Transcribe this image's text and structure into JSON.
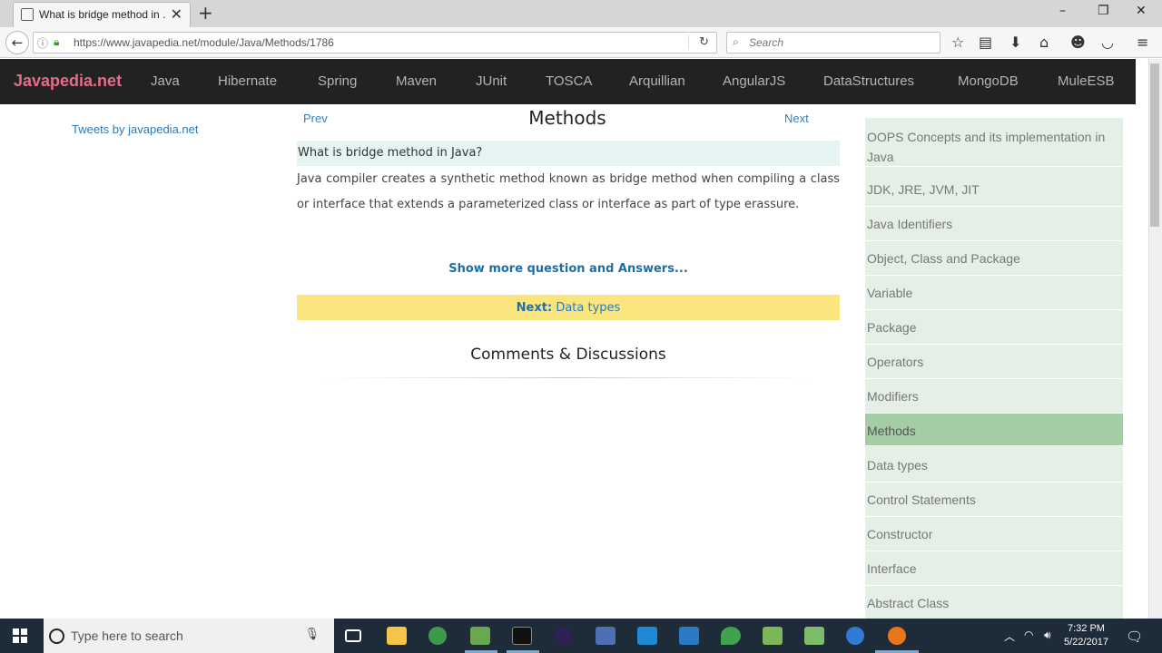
{
  "browser": {
    "tab_title": "What is bridge method in ...",
    "url": "https://www.javapedia.net/module/Java/Methods/1786",
    "search_placeholder": "Search"
  },
  "site": {
    "brand": "Javapedia.net",
    "nav": [
      "Java",
      "Hibernate",
      "Spring",
      "Maven",
      "JUnit",
      "TOSCA",
      "Arquillian",
      "AngularJS",
      "DataStructures",
      "MongoDB",
      "MuleESB"
    ]
  },
  "left": {
    "tweets_link": "Tweets by javapedia.net"
  },
  "main": {
    "prev": "Prev",
    "next": "Next",
    "title": "Methods",
    "question": "What is bridge method in Java?",
    "answer": "Java compiler creates a synthetic method known as bridge method when compiling a class or interface that extends a parameterized class or interface as part of type erassure.",
    "show_more": "Show more question and Answers...",
    "next_bar_label": "Next:",
    "next_bar_link": "Data types",
    "comments_heading": "Comments & Discussions"
  },
  "sidebar": {
    "items": [
      "OOPS Concepts and its implementation in Java",
      "JDK, JRE, JVM, JIT",
      "Java Identifiers",
      "Object, Class and Package",
      "Variable",
      "Package",
      "Operators",
      "Modifiers",
      "Methods",
      "Data types",
      "Control Statements",
      "Constructor",
      "Interface",
      "Abstract Class"
    ],
    "active": "Methods"
  },
  "taskbar": {
    "search_placeholder": "Type here to search",
    "time": "7:32 PM",
    "date": "5/22/2017"
  }
}
